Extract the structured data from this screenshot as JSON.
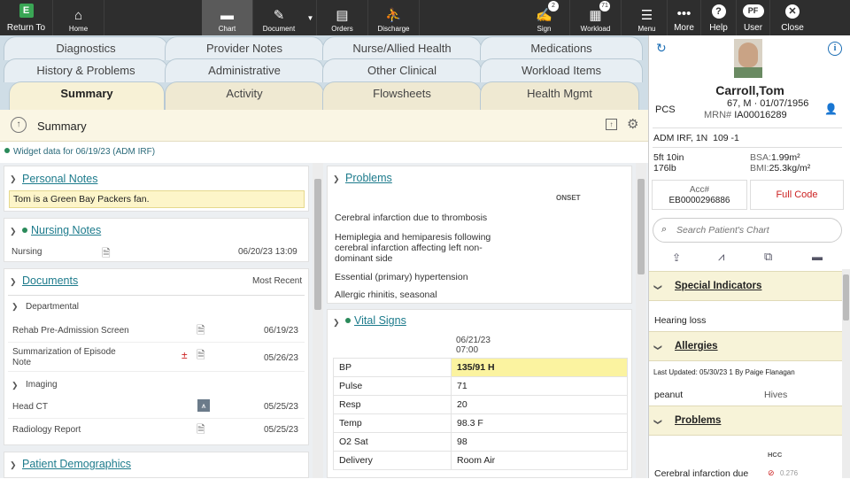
{
  "topbar": {
    "return_to": "Return To",
    "home": "Home",
    "chart": "Chart",
    "document": "Document",
    "orders": "Orders",
    "discharge": "Discharge",
    "sign": "Sign",
    "sign_count": "2",
    "workload": "Workload",
    "workload_count": "71",
    "menu": "Menu",
    "more": "More",
    "help": "Help",
    "user": "User",
    "user_initials": "PF",
    "close": "Close"
  },
  "tabs": {
    "row1": [
      "Diagnostics",
      "Provider Notes",
      "Nurse/Allied Health",
      "Medications"
    ],
    "row2": [
      "History & Problems",
      "Administrative",
      "Other Clinical",
      "Workload Items"
    ],
    "row3": [
      "Summary",
      "Activity",
      "Flowsheets",
      "Health Mgmt"
    ]
  },
  "summary_header": {
    "title": "Summary"
  },
  "widget_date": "Widget data for 06/19/23 (ADM IRF)",
  "personal_notes": {
    "title": "Personal Notes",
    "note": "Tom is a Green Bay Packers fan."
  },
  "nursing_notes": {
    "title": "Nursing Notes",
    "item": "Nursing",
    "date": "06/20/23 13:09"
  },
  "documents": {
    "title": "Documents",
    "filter": "Most Recent",
    "dept_label": "Departmental",
    "dept_items": [
      {
        "name": "Rehab Pre-Admission Screen",
        "date": "06/19/23"
      },
      {
        "name1": "Summarization of Episode",
        "name2": "Note",
        "date": "05/26/23"
      }
    ],
    "imaging_label": "Imaging",
    "imaging_items": [
      {
        "name": "Head CT",
        "date": "05/25/23"
      },
      {
        "name": "Radiology Report",
        "date": "05/25/23"
      }
    ]
  },
  "demographics": {
    "title": "Patient Demographics"
  },
  "problems": {
    "title": "Problems",
    "col_onset": "ONSET",
    "items": [
      "Cerebral infarction due to thrombosis",
      "Hemiplegia and hemiparesis following",
      "cerebral infarction affecting left non-",
      "dominant side",
      "Essential (primary) hypertension",
      "Allergic rhinitis, seasonal"
    ]
  },
  "vitals": {
    "title": "Vital Signs",
    "date": "06/21/23",
    "time": "07:00",
    "rows": [
      {
        "label": "BP",
        "value": "135/91 H"
      },
      {
        "label": "Pulse",
        "value": "71"
      },
      {
        "label": "Resp",
        "value": "20"
      },
      {
        "label": "Temp",
        "value": "98.3 F"
      },
      {
        "label": "O2 Sat",
        "value": "98"
      },
      {
        "label": "Delivery",
        "value": "Room Air"
      }
    ]
  },
  "patient": {
    "name": "Carroll,Tom",
    "pcs": "PCS",
    "age_sex": "67, M",
    "dob": "01/07/1956",
    "mrn_label": "MRN#",
    "mrn": "IA00016289",
    "encounter": "ADM IRF, 1N",
    "room": "109 -1",
    "height": "5ft 10in",
    "weight": "176lb",
    "bsa_label": "BSA:",
    "bsa": "1.99m²",
    "bmi_label": "BMI:",
    "bmi": "25.3kg/m²",
    "acc_label": "Acc#",
    "acc": "EB0000296886",
    "code_status": "Full Code"
  },
  "search": {
    "placeholder": "Search Patient's Chart"
  },
  "special_indicators": {
    "title": "Special Indicators",
    "item": "Hearing loss"
  },
  "allergies": {
    "title": "Allergies",
    "updated": "Last Updated: 05/30/23 1 By Paige Flanagan",
    "allergen": "peanut",
    "reaction": "Hives"
  },
  "rp_problems": {
    "title": "Problems",
    "col_hcc": "HCC",
    "item": "Cerebral infarction due",
    "score": "0.276"
  },
  "colors": {
    "accent": "#1d7b8c",
    "danger": "#cc2222",
    "highlight": "#fbf3a0"
  }
}
